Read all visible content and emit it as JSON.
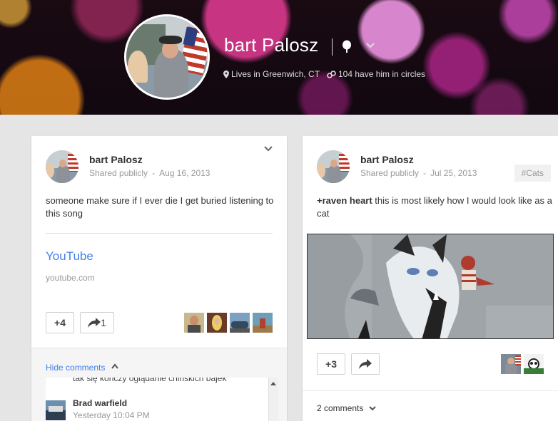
{
  "profile": {
    "name": "bart Palosz",
    "location": "Lives in Greenwich, CT",
    "circles": "104 have him in circles"
  },
  "posts": [
    {
      "author": "bart Palosz",
      "visibility": "Shared publicly",
      "date": "Aug 16, 2013",
      "text": "someone make sure if I ever die I get buried listening to this song",
      "link_title": "YouTube",
      "link_domain": "youtube.com",
      "plus_count": "+4",
      "share_count": "1",
      "hide_comments_label": "Hide comments",
      "comments": [
        {
          "text": "tak się kończy oglądanie chińskich bajek"
        },
        {
          "author": "Brad warfield",
          "time": "Yesterday 10:04 PM"
        }
      ]
    },
    {
      "author": "bart Palosz",
      "visibility": "Shared publicly",
      "date": "Jul 25, 2013",
      "tag": "#Cats",
      "mention": "+raven heart",
      "text": " this is most likely how I would look like as a cat",
      "plus_count": "+3",
      "comments_label": "2 comments"
    }
  ],
  "icons": [
    "pin-icon",
    "chevron-down-icon",
    "location-icon",
    "circles-icon",
    "share-arrow-icon",
    "chevron-up-icon"
  ]
}
